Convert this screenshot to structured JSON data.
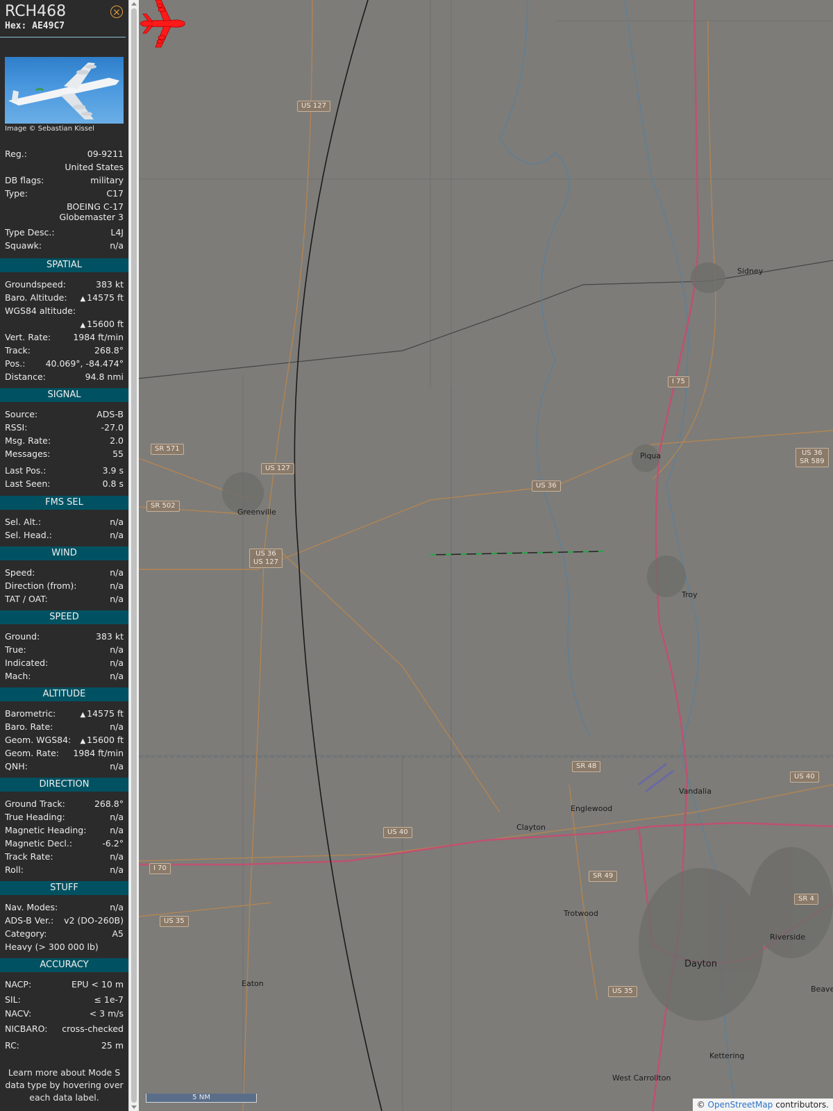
{
  "header": {
    "callsign": "RCH468",
    "hex": "Hex: AE49C7",
    "close_icon": "close-icon"
  },
  "photo": {
    "credit": "Image © Sebastian Kissel"
  },
  "info": [
    {
      "k": "Reg.:",
      "v": "09-9211"
    },
    {
      "k": "",
      "v": "United States"
    },
    {
      "k": "DB flags:",
      "v": "military"
    },
    {
      "k": "Type:",
      "v": "C17"
    },
    {
      "k": "",
      "v": "BOEING C-17 Globemaster 3"
    },
    {
      "k": "Type Desc.:",
      "v": "L4J"
    },
    {
      "k": "Squawk:",
      "v": "n/a"
    }
  ],
  "sections": {
    "spatial": "SPATIAL",
    "signal": "SIGNAL",
    "fms": "FMS SEL",
    "wind": "WIND",
    "speed": "SPEED",
    "altitude": "ALTITUDE",
    "direction": "DIRECTION",
    "stuff": "STUFF",
    "accuracy": "ACCURACY"
  },
  "spatial": [
    {
      "k": "Groundspeed:",
      "v": "383 kt"
    },
    {
      "k": "Baro. Altitude:",
      "v": "14575 ft"
    },
    {
      "k": "WGS84 altitude:",
      "v": ""
    },
    {
      "k": "",
      "v": "15600 ft"
    },
    {
      "k": "Vert. Rate:",
      "v": "1984 ft/min"
    },
    {
      "k": "Track:",
      "v": "268.8°"
    },
    {
      "k": "Pos.:",
      "v": "40.069°, -84.474°"
    },
    {
      "k": "Distance:",
      "v": "94.8 nmi"
    }
  ],
  "signal": [
    {
      "k": "Source:",
      "v": "ADS-B"
    },
    {
      "k": "RSSI:",
      "v": "-27.0"
    },
    {
      "k": "Msg. Rate:",
      "v": "2.0"
    },
    {
      "k": "Messages:",
      "v": "55"
    },
    {
      "k": "Last Pos.:",
      "v": "3.9 s"
    },
    {
      "k": "Last Seen:",
      "v": "0.8 s"
    }
  ],
  "fms": [
    {
      "k": "Sel. Alt.:",
      "v": "n/a"
    },
    {
      "k": "Sel. Head.:",
      "v": "n/a"
    }
  ],
  "wind": [
    {
      "k": "Speed:",
      "v": "n/a"
    },
    {
      "k": "Direction (from):",
      "v": "n/a"
    },
    {
      "k": "TAT / OAT:",
      "v": "n/a"
    }
  ],
  "speed": [
    {
      "k": "Ground:",
      "v": "383 kt"
    },
    {
      "k": "True:",
      "v": "n/a"
    },
    {
      "k": "Indicated:",
      "v": "n/a"
    },
    {
      "k": "Mach:",
      "v": "n/a"
    }
  ],
  "altitude": [
    {
      "k": "Barometric:",
      "v": "14575 ft"
    },
    {
      "k": "Baro. Rate:",
      "v": "n/a"
    },
    {
      "k": "Geom. WGS84:",
      "v": "15600 ft"
    },
    {
      "k": "Geom. Rate:",
      "v": "1984 ft/min"
    },
    {
      "k": "QNH:",
      "v": "n/a"
    }
  ],
  "direction": [
    {
      "k": "Ground Track:",
      "v": "268.8°"
    },
    {
      "k": "True Heading:",
      "v": "n/a"
    },
    {
      "k": "Magnetic Heading:",
      "v": "n/a"
    },
    {
      "k": "Magnetic Decl.:",
      "v": "-6.2°"
    },
    {
      "k": "Track Rate:",
      "v": "n/a"
    },
    {
      "k": "Roll:",
      "v": "n/a"
    }
  ],
  "stuff": [
    {
      "k": "Nav. Modes:",
      "v": "n/a"
    },
    {
      "k": "ADS-B Ver.:",
      "v": "v2 (DO-260B)"
    },
    {
      "k": "Category:",
      "v": "A5"
    },
    {
      "k": "Heavy (> 300 000 lb)",
      "v": ""
    }
  ],
  "accuracy": [
    {
      "k": "NACP:",
      "v": "EPU < 10 m"
    },
    {
      "k": "SIL:",
      "v": "≤ 1e-7"
    },
    {
      "k": "NACV:",
      "v": "< 3 m/s"
    },
    {
      "k": "NICBARO:",
      "v": "cross-checked"
    },
    {
      "k": "RC:",
      "v": "25 m"
    }
  ],
  "footnote": "Learn more about Mode S data type by hovering over each data label.",
  "map": {
    "shields": [
      "US 127",
      "US 127",
      "SR 571",
      "SR 502",
      "US 36\nUS 127",
      "US 36",
      "I 75",
      "US 36\nSR 589",
      "SR 48",
      "US 40",
      "US 40",
      "I 70",
      "SR 49",
      "US 35",
      "US 35",
      "SR 4"
    ],
    "towns": [
      "Sidney",
      "Piqua",
      "Greenville",
      "Troy",
      "Vandalia",
      "Englewood",
      "Clayton",
      "Trotwood",
      "Riverside",
      "Dayton",
      "Eaton",
      "Kettering",
      "West Carrollton",
      "Beaver"
    ],
    "scale": "5 NM",
    "attribution_prefix": "© ",
    "attribution_link": "OpenStreetMap",
    "attribution_suffix": " contributors."
  },
  "colors": {
    "sidebar_bg": "#2b2b2b",
    "section_bg": "#005262",
    "plane": "#ff1a1a",
    "track": "#22aa44"
  },
  "icons": {
    "plane": "airplane-icon",
    "close": "close-icon"
  }
}
